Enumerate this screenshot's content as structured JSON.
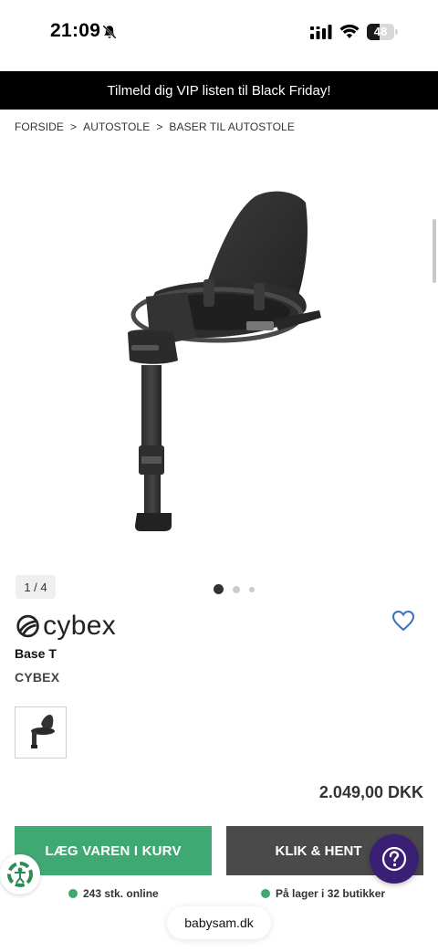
{
  "status_bar": {
    "time": "21:09",
    "battery_level": "48",
    "battery_fraction": 0.48
  },
  "promo_banner": {
    "text": "Tilmeld dig VIP listen til Black Friday!"
  },
  "breadcrumb": [
    "FORSIDE",
    "AUTOSTOLE",
    "BASER TIL AUTOSTOLE"
  ],
  "breadcrumb_separator": ">",
  "gallery": {
    "counter": "1 / 4",
    "current_index": 1,
    "total": 4,
    "image_icon": "car-seat-base-image"
  },
  "product": {
    "brand_logo_text": "cybex",
    "name": "Base T",
    "brand": "CYBEX",
    "price": "2.049,00 DKK"
  },
  "actions": {
    "add_to_cart": "LÆG VAREN I KURV",
    "click_collect": "KLIK & HENT"
  },
  "stock": {
    "online": "243 stk. online",
    "stores": "På lager i 32 butikker"
  },
  "browser": {
    "url": "babysam.dk"
  },
  "colors": {
    "banner_bg": "#000000",
    "cart_green": "#3fa873",
    "collect_gray": "#4a4a4a",
    "help_purple": "#3a1f75",
    "wishlist_blue": "#3a6fc4"
  },
  "icons": {
    "bell": "bell-slash-icon",
    "signal": "cellular-signal-icon",
    "wifi": "wifi-icon",
    "wishlist": "heart-outline-icon",
    "help": "question-mark-icon",
    "accessibility": "accessibility-icon"
  }
}
